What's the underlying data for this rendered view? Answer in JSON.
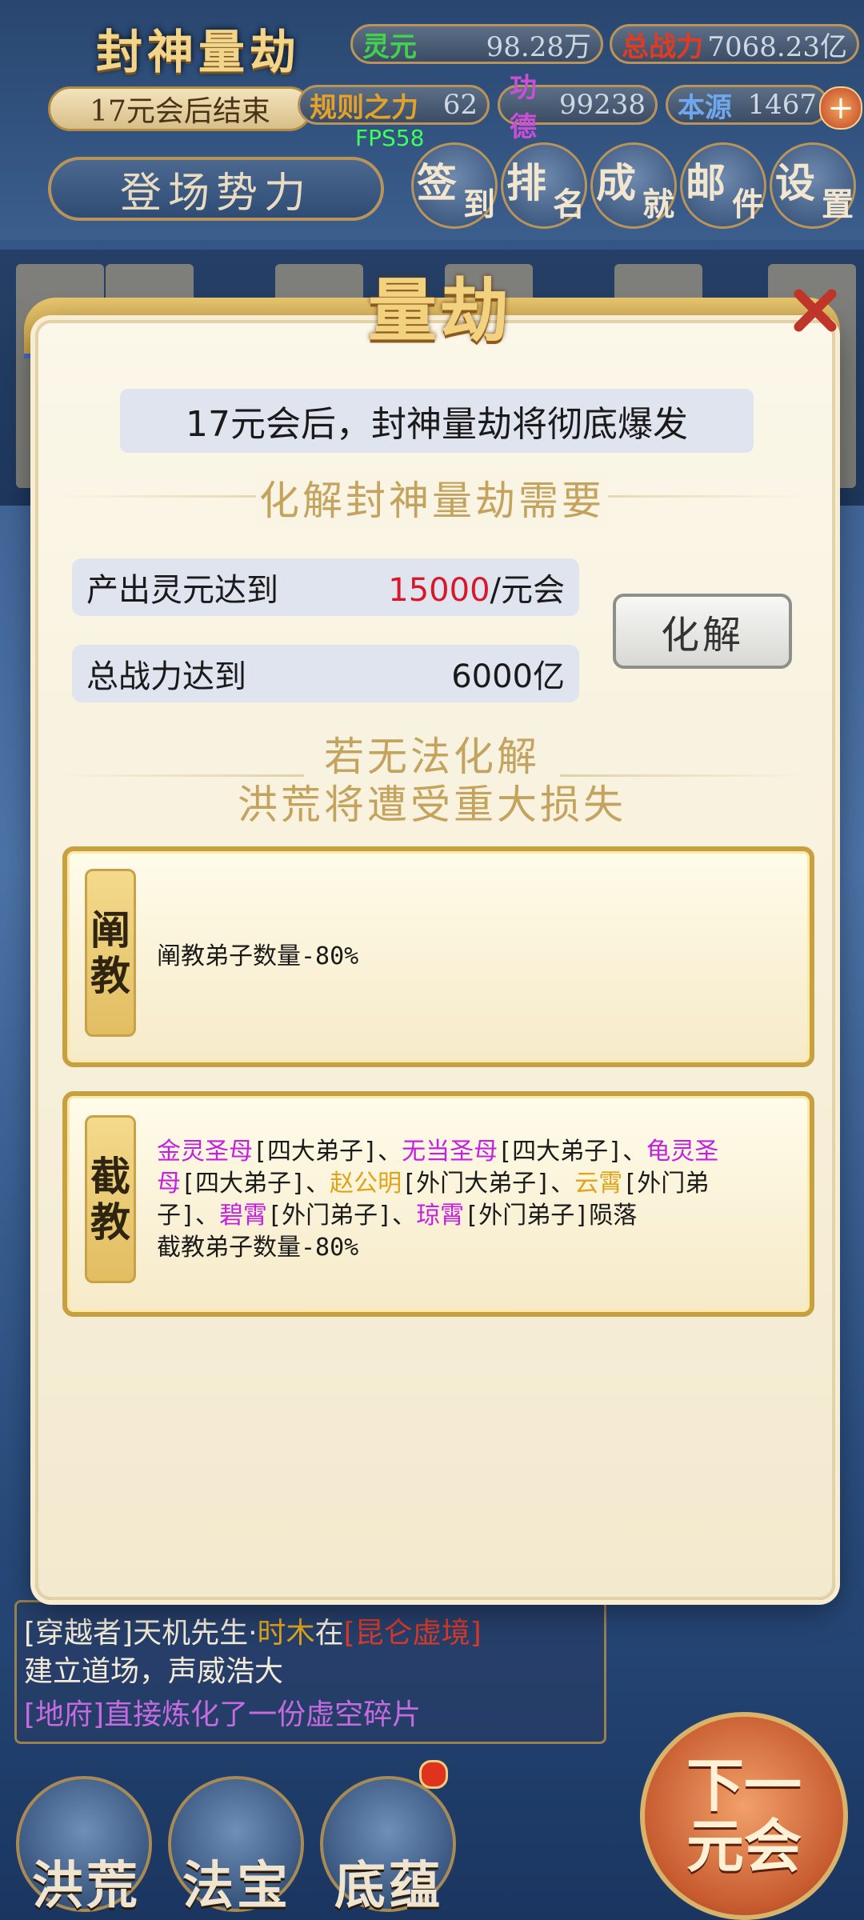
{
  "hud": {
    "title": "封神量劫",
    "lingyuan_label": "灵元",
    "lingyuan_value": "98.28万",
    "power_label": "总战力",
    "power_value": "7068.23亿",
    "timer": "17元会后结束",
    "rule_label": "规则之力",
    "rule_value": "62",
    "merit_label": "功德",
    "merit_value": "99238",
    "origin_label": "本源",
    "origin_value": "1467",
    "fps": "FPS58",
    "faction_button": "登场势力",
    "menu": [
      {
        "a": "签",
        "b": "到"
      },
      {
        "a": "排",
        "b": "名"
      },
      {
        "a": "成",
        "b": "就"
      },
      {
        "a": "邮",
        "b": "件"
      },
      {
        "a": "设",
        "b": "置"
      }
    ]
  },
  "modal": {
    "title": "量劫",
    "notice": "17元会后，封神量劫将彻底爆发",
    "requirements_title": "化解封神量劫需要",
    "req1_label": "产出灵元达到",
    "req1_value": "15000",
    "req1_unit": "/元会",
    "req2_label": "总战力达到",
    "req2_value": "6000亿",
    "resolve_button": "化解",
    "fail_line1": "若无法化解",
    "fail_line2": "洪荒将遭受重大损失",
    "cards": {
      "chan": {
        "tag1": "阐",
        "tag2": "教",
        "text": "阐教弟子数量-80%"
      },
      "jie": {
        "tag1": "截",
        "tag2": "教",
        "name1": "金灵圣母",
        "role1": "[四大弟子]、",
        "name2": "无当圣母",
        "role2": "[四大弟子]、",
        "name3a": "龟灵圣",
        "name3b": "母",
        "role3": "[四大弟子]、",
        "name4": "赵公明",
        "role4": "[外门大弟子]、",
        "name5": "云霄",
        "role5a": "[外门弟",
        "role5b": "子]、",
        "name6": "碧霄",
        "role6": "[外门弟子]、",
        "name7": "琼霄",
        "role7": "[外门弟子]陨落",
        "line4": "截教弟子数量-80%"
      }
    }
  },
  "log": {
    "line1_prefix": "[穿越者]天机先生·",
    "line1_name": "时木",
    "line1_mid": "在",
    "line1_place": "[昆仑虚境]",
    "line2": "建立道场，声威浩大",
    "line3": "[地府]直接炼化了一份虚空碎片"
  },
  "bottom": {
    "btn1": "洪荒",
    "btn2": "法宝",
    "btn3": "底蕴",
    "next1": "下一",
    "next2": "元会"
  }
}
